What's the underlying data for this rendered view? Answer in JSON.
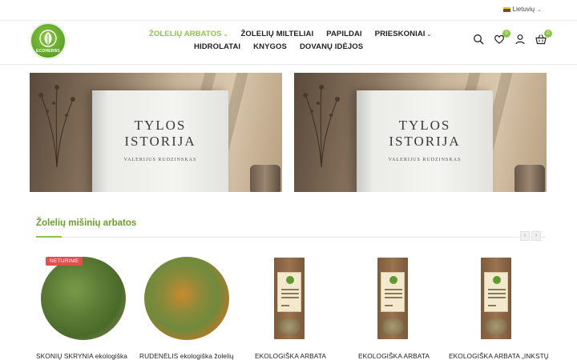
{
  "topbar": {
    "language": "Lietuvių",
    "language_flag_colors": [
      "#f5c518",
      "#0a7a3b",
      "#c1272d"
    ]
  },
  "brand": {
    "logo_text": "ECOHERBS",
    "accent_color": "#8cc63f"
  },
  "nav": {
    "row1": [
      {
        "label": "ŽOLELIŲ ARBATOS",
        "active": true,
        "dropdown": true
      },
      {
        "label": "ŽOLELIŲ MILTELIAI",
        "active": false,
        "dropdown": false
      },
      {
        "label": "PAPILDAI",
        "active": false,
        "dropdown": false
      },
      {
        "label": "PRIESKONIAI",
        "active": false,
        "dropdown": true
      }
    ],
    "row2": [
      {
        "label": "HIDROLATAI"
      },
      {
        "label": "KNYGOS"
      },
      {
        "label": "DOVANŲ IDĖJOS"
      }
    ]
  },
  "header_icons": {
    "search": "search-icon",
    "wishlist": "heart-icon",
    "wishlist_count": "0",
    "account": "user-icon",
    "cart": "basket-icon",
    "cart_count": "0"
  },
  "banners": [
    {
      "title_line1": "TYLOS",
      "title_line2": "ISTORIJA",
      "author": "VALERIJUS RUDZINSKAS"
    },
    {
      "title_line1": "TYLOS",
      "title_line2": "ISTORIJA",
      "author": "VALERIJUS RUDZINSKAS"
    }
  ],
  "section": {
    "title": "Žolelių mišinių arbatos",
    "prev_icon": "chevron-left-icon",
    "next_icon": "chevron-right-icon"
  },
  "products": [
    {
      "name": "SKONIŲ SKRYNIA ekologiška",
      "tag": "NETURIME",
      "image": "herb-mix-green"
    },
    {
      "name": "RUDENĖLIS ekologiška žolelių",
      "tag": "",
      "image": "herb-mix-orange"
    },
    {
      "name": "EKOLOGIŠKA ARBATA",
      "tag": "",
      "image": "tea-pouch"
    },
    {
      "name": "EKOLOGIŠKA ARBATA",
      "tag": "",
      "image": "tea-pouch"
    },
    {
      "name": "EKOLOGIŠKA ARBATA „INKSTŲ",
      "tag": "",
      "image": "tea-pouch"
    }
  ]
}
